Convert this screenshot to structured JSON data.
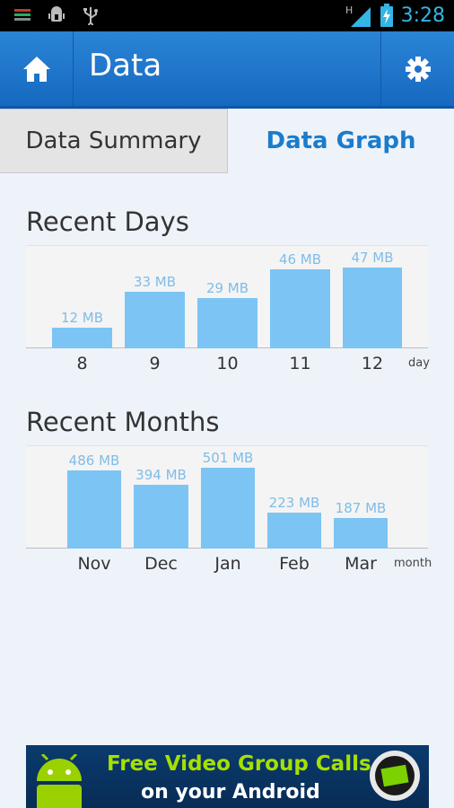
{
  "status_bar": {
    "time": "3:28",
    "network": "H",
    "icons": [
      "app-notification-icon",
      "android-debug-icon",
      "usb-icon",
      "signal-icon",
      "battery-charging-icon"
    ]
  },
  "action_bar": {
    "title": "Data",
    "home_icon": "home-icon",
    "settings_icon": "gear-icon"
  },
  "tabs": [
    {
      "label": "Data Summary",
      "selected": false
    },
    {
      "label": "Data Graph",
      "selected": true
    }
  ],
  "recent_days": {
    "title": "Recent Days",
    "unit_label": "day"
  },
  "recent_months": {
    "title": "Recent Months",
    "unit_label": "month"
  },
  "chart_data": [
    {
      "type": "bar",
      "title": "Recent Days",
      "xlabel": "day",
      "categories": [
        "8",
        "9",
        "10",
        "11",
        "12"
      ],
      "values": [
        12,
        33,
        29,
        46,
        47
      ],
      "labels": [
        "12 MB",
        "33 MB",
        "29 MB",
        "46 MB",
        "47 MB"
      ],
      "ylim": [
        0,
        47
      ],
      "bar_color": "#7cc4f4"
    },
    {
      "type": "bar",
      "title": "Recent Months",
      "xlabel": "month",
      "categories": [
        "Nov",
        "Dec",
        "Jan",
        "Feb",
        "Mar"
      ],
      "values": [
        486,
        394,
        501,
        223,
        187
      ],
      "labels": [
        "486 MB",
        "394 MB",
        "501 MB",
        "223 MB",
        "187 MB"
      ],
      "ylim": [
        0,
        501
      ],
      "bar_color": "#7cc4f4"
    }
  ],
  "ad_banner": {
    "line1": "Free Video Group Calls",
    "line2": "on your Android",
    "line1_color": "#a6e000"
  },
  "colors": {
    "accent": "#1b7ccc",
    "action_bar": "#1f77cc",
    "clock": "#33b5e5"
  }
}
